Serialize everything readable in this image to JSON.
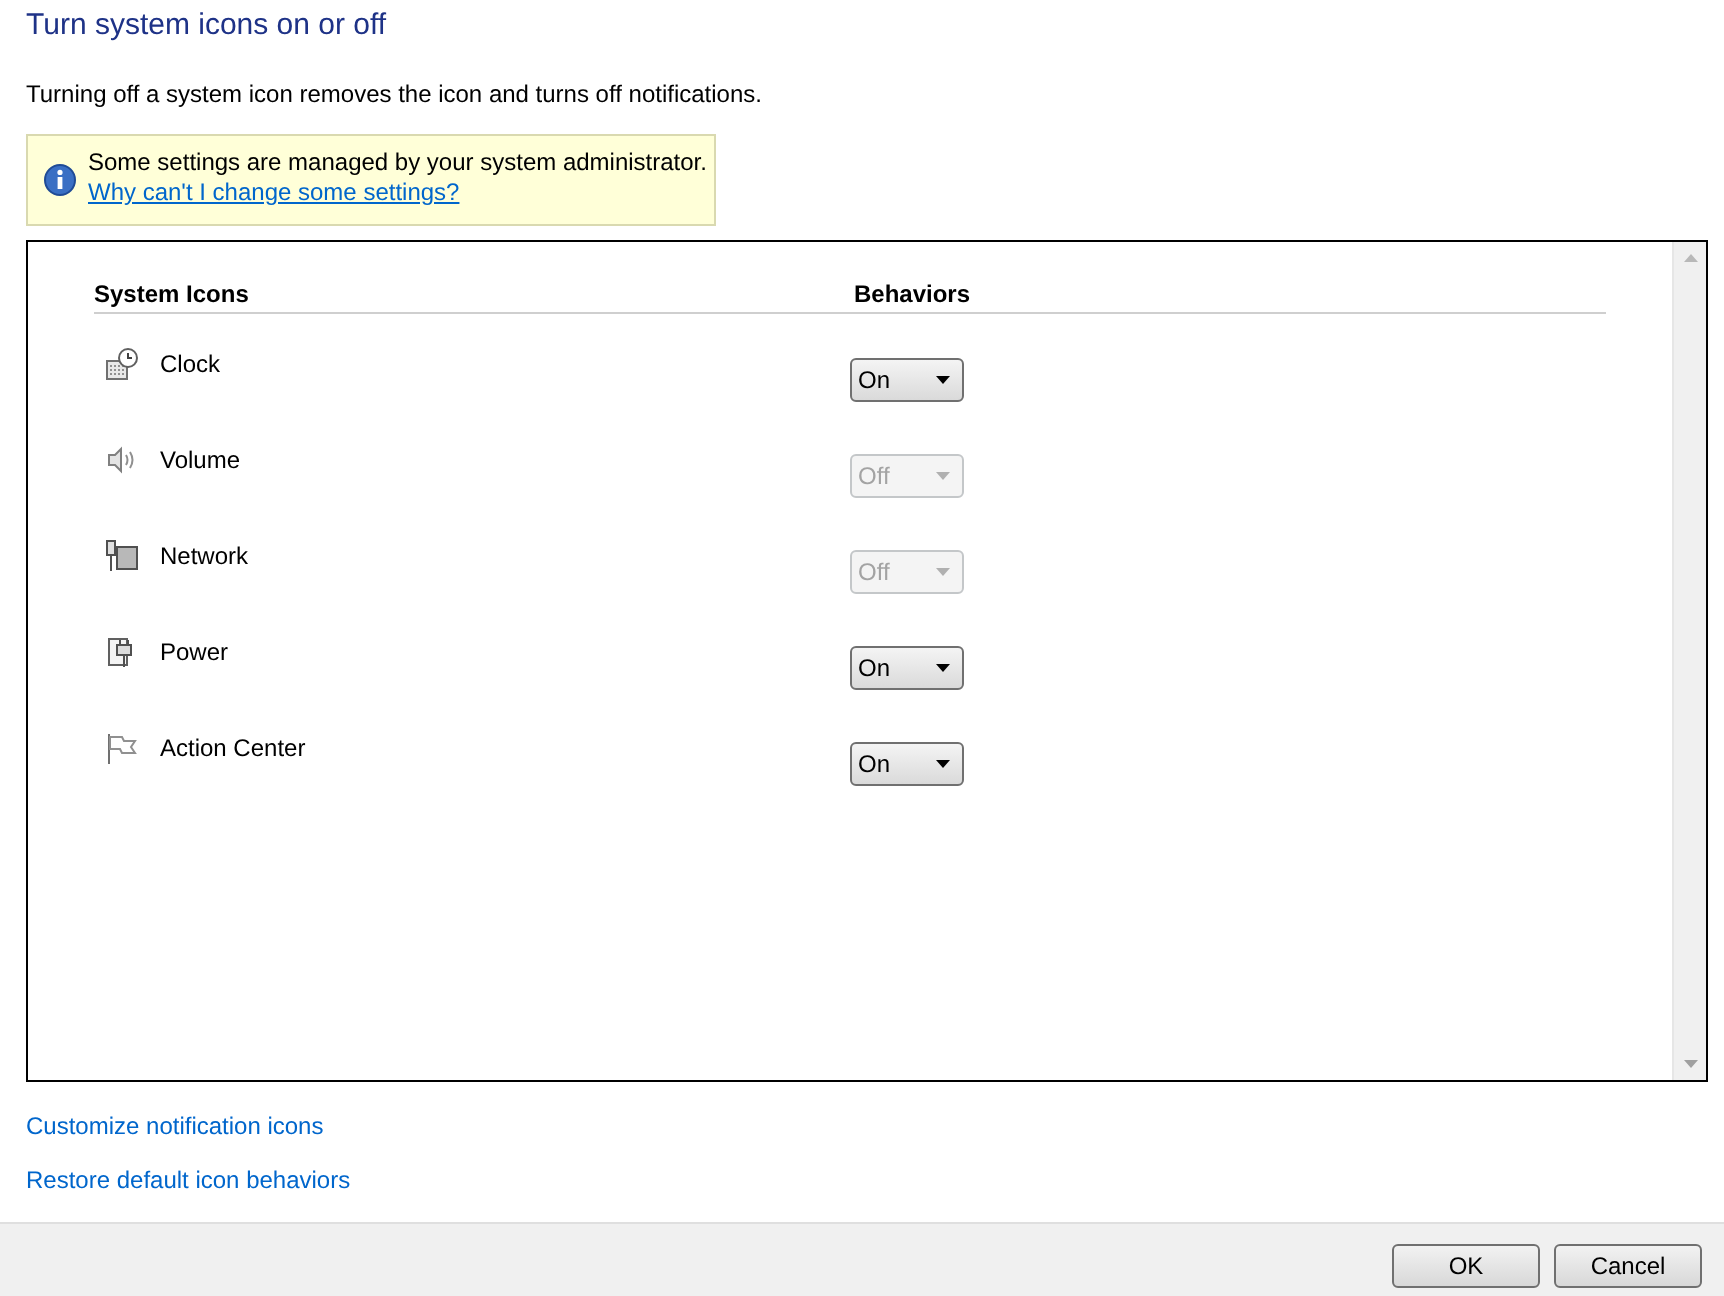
{
  "page": {
    "title": "Turn system icons on or off",
    "description": "Turning off a system icon removes the icon and turns off notifications."
  },
  "notice": {
    "text": "Some settings are managed by your system administrator.",
    "link": "Why can't I change some settings?"
  },
  "table": {
    "columns": [
      "System Icons",
      "Behaviors"
    ],
    "rows": [
      {
        "kind": "clock",
        "name": "Clock",
        "behavior": "On",
        "disabled": false
      },
      {
        "kind": "volume",
        "name": "Volume",
        "behavior": "Off",
        "disabled": true
      },
      {
        "kind": "network",
        "name": "Network",
        "behavior": "Off",
        "disabled": true
      },
      {
        "kind": "power",
        "name": "Power",
        "behavior": "On",
        "disabled": false
      },
      {
        "kind": "flag",
        "name": "Action Center",
        "behavior": "On",
        "disabled": false
      }
    ]
  },
  "links": [
    "Customize notification icons",
    "Restore default icon behaviors"
  ],
  "buttons": [
    "OK",
    "Cancel"
  ]
}
